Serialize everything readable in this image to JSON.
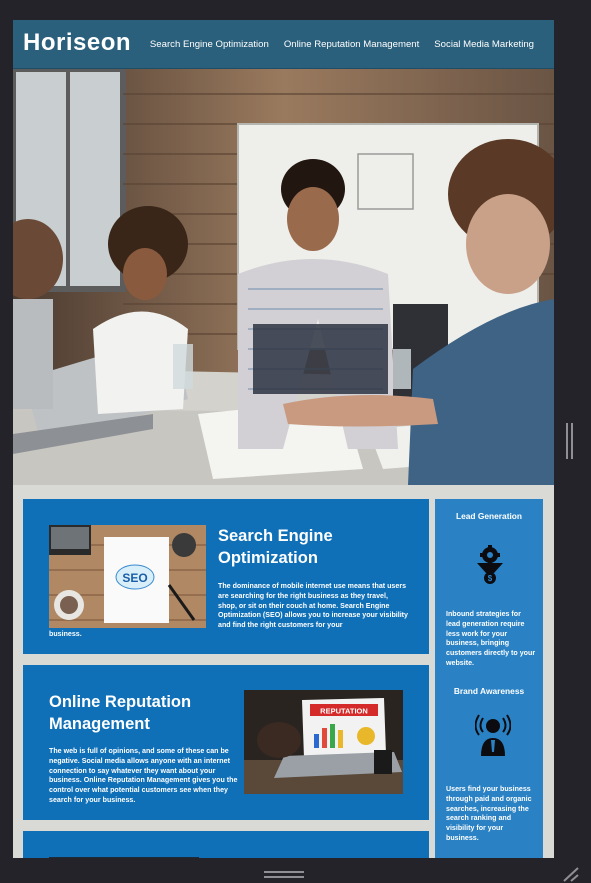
{
  "header": {
    "logo": "Horiseon",
    "nav": [
      "Search Engine Optimization",
      "Online Reputation Management",
      "Social Media Marketing"
    ]
  },
  "sections": {
    "seo": {
      "title": "Search Engine Optimization",
      "body_right": "The dominance of mobile internet use means that users are searching for the right business as they travel, shop, or sit on their couch at home. Search Engine Optimization (SEO) allows you to increase your visibility and find the right customers for your",
      "body_tail": "business.",
      "image_text": "SEO"
    },
    "orm": {
      "title": "Online Reputation Management",
      "body": "The web is full of opinions, and some of these can be negative. Social media allows anyone with an internet connection to say whatever they want about your business. Online Reputation Management gives you the control over what potential customers see when they search for your business.",
      "image_text": "REPUTATION"
    }
  },
  "benefits": [
    {
      "title": "Lead Generation",
      "icon": "funnel-gear-icon",
      "body": "Inbound strategies for lead generation require less work for your business, bringing customers directly to your website."
    },
    {
      "title": "Brand Awareness",
      "icon": "broadcast-person-icon",
      "body": "Users find your business through paid and organic searches, increasing the search ranking and visibility for your business."
    }
  ],
  "colors": {
    "header_bg": "#2a607c",
    "card_bg": "#0f70b8",
    "sidebar_bg": "#2a82c4",
    "page_bg": "#d9dad6",
    "chrome_bg": "#242329"
  }
}
